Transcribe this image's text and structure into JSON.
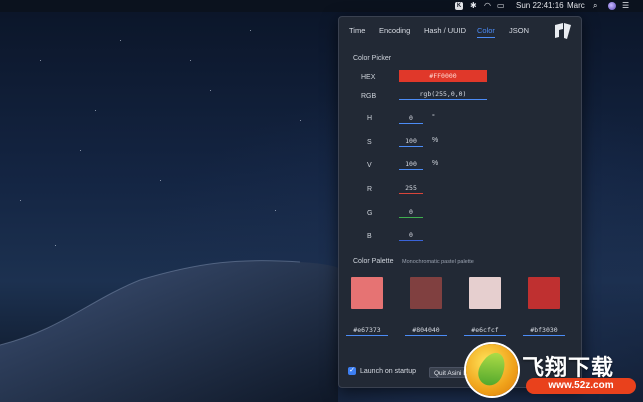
{
  "menubar": {
    "clock": "Sun 22:41:16",
    "user": "Marc",
    "app_icon_glyph": "K"
  },
  "tabs": [
    {
      "label": "Time"
    },
    {
      "label": "Encoding"
    },
    {
      "label": "Hash / UUID"
    },
    {
      "label": "Color",
      "active": true
    },
    {
      "label": "JSON"
    }
  ],
  "color_picker": {
    "title": "Color Picker",
    "hex_label": "HEX",
    "hex_value": "#FF0000",
    "rgb_label": "RGB",
    "rgb_value": "rgb(255,0,0)",
    "h_label": "H",
    "h_value": "0",
    "h_unit": "°",
    "s_label": "S",
    "s_value": "100",
    "s_unit": "%",
    "v_label": "V",
    "v_value": "100",
    "v_unit": "%",
    "r_label": "R",
    "r_value": "255",
    "g_label": "G",
    "g_value": "0",
    "b_label": "B",
    "b_value": "0"
  },
  "palette": {
    "title": "Color Palette",
    "subtitle": "Monochromatic pastel palette",
    "swatches": [
      {
        "hex": "#e67373"
      },
      {
        "hex": "#804040"
      },
      {
        "hex": "#e6cfcf"
      },
      {
        "hex": "#bf3030"
      }
    ]
  },
  "footer": {
    "launch_label": "Launch on startup",
    "launch_checked": true,
    "quit_label": "Quit Asini De"
  },
  "colors": {
    "accent": "#4c8cf6",
    "hex_box": "#e0382a",
    "r_underline": "#d9453a",
    "g_underline": "#3fae4f",
    "b_underline": "#3a63d8"
  },
  "watermark": {
    "text": "飞翔下载",
    "url": "www.52z.com"
  }
}
